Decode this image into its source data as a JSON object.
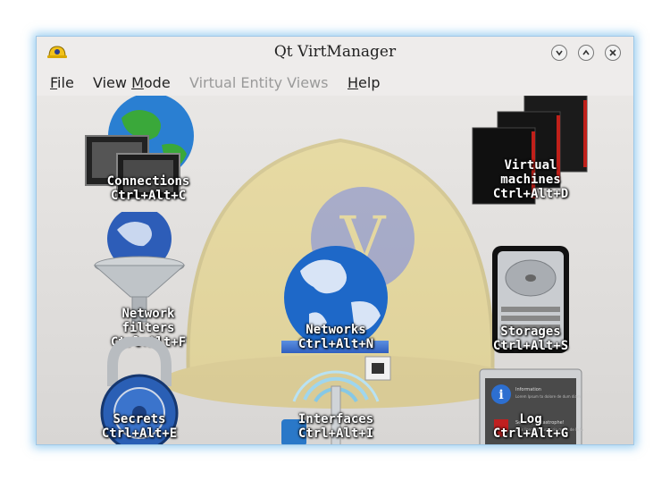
{
  "window": {
    "title": "Qt  VirtManager",
    "controls": [
      "minimize-icon",
      "maximize-icon",
      "close-icon"
    ]
  },
  "menu": {
    "file": {
      "prefix": "",
      "mnemonic": "F",
      "rest": "ile"
    },
    "view_mode": {
      "prefix": "View ",
      "mnemonic": "M",
      "rest": "ode"
    },
    "virtual_entity_views": {
      "label": "Virtual Entity Views",
      "enabled": false
    },
    "help": {
      "prefix": "",
      "mnemonic": "H",
      "rest": "elp"
    }
  },
  "tiles": {
    "connections": {
      "line1": "Connections",
      "line2": "Ctrl+Alt+C",
      "icon": "monitors-globe-icon"
    },
    "virtual_machines": {
      "line1": "Virtual",
      "line2": "machines",
      "line3": "Ctrl+Alt+D",
      "icon": "server-rack-icon"
    },
    "network_filters": {
      "line1": "Network",
      "line2": "filters",
      "line3": "Ctrl+Alt+F",
      "icon": "funnel-globe-icon"
    },
    "networks": {
      "line1": "Networks",
      "line2": "Ctrl+Alt+N",
      "icon": "globe-icon",
      "selected": true
    },
    "storages": {
      "line1": "Storages",
      "line2": "Ctrl+Alt+S",
      "icon": "hard-drive-icon"
    },
    "secrets": {
      "line1": "Secrets",
      "line2": "Ctrl+Alt+E",
      "icon": "padlock-icon"
    },
    "interfaces": {
      "line1": "Interfaces",
      "line2": "Ctrl+Alt+I",
      "icon": "antenna-icon"
    },
    "log": {
      "line1": "Log",
      "line2": "Ctrl+Alt+G",
      "icon": "log-window-icon"
    }
  },
  "log_preview": {
    "info_title": "Information",
    "info_text": "Lorem lpsum to dolore de dum diam",
    "error_title": "Security Catastrophe!",
    "error_text": "Quis litera et blum dolo mega de la fa"
  },
  "colors": {
    "accent": "#2f5fbf",
    "window_glow": "#50aae6"
  }
}
